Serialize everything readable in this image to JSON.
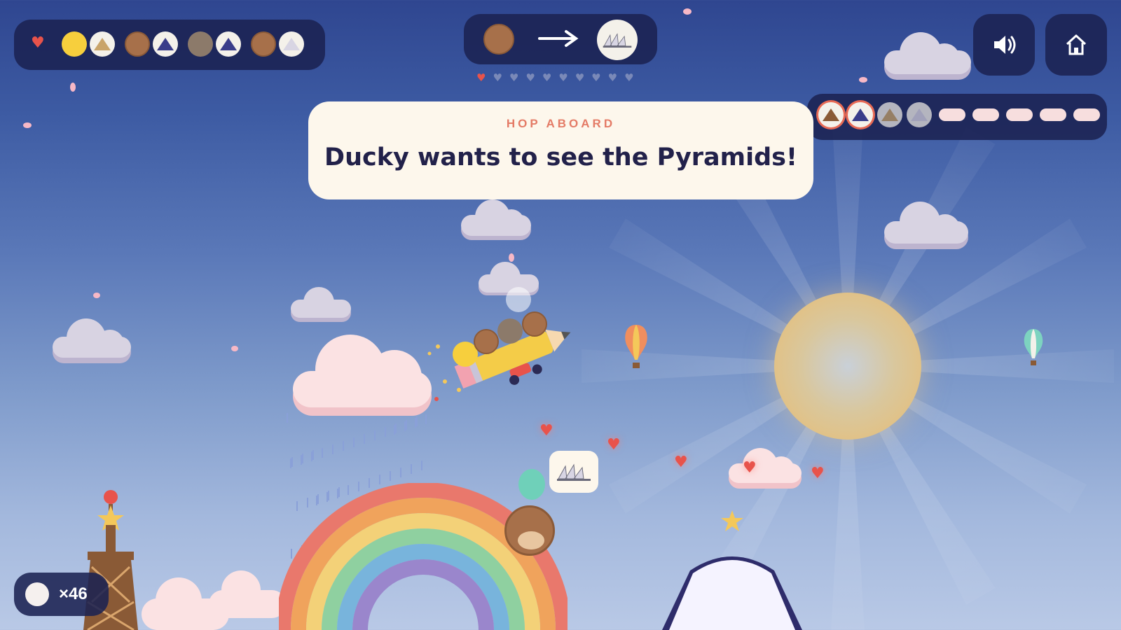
{
  "hud": {
    "passengers": {
      "lives_icon": "heart-icon",
      "pairs": [
        {
          "rider": "duck",
          "destination": "pyramids"
        },
        {
          "rider": "bear",
          "destination": "mount-fuji"
        },
        {
          "rider": "hedgehog",
          "destination": "mount-fuji"
        },
        {
          "rider": "bear",
          "destination": "sydney-opera-house"
        }
      ]
    },
    "current_route": {
      "from": "bear",
      "arrow_icon": "arrow-right-icon",
      "to": "sydney-opera-house",
      "progress_filled": 1,
      "progress_total": 10
    },
    "sound_icon": "speaker-icon",
    "home_icon": "home-icon",
    "collection": {
      "visited": [
        "eiffel-tower",
        "mount-fuji"
      ],
      "known": [
        "pyramids",
        "sydney-opera-house"
      ],
      "locked_count": 5
    }
  },
  "banner": {
    "kicker": "HOP ABOARD",
    "message": "Ducky wants to see the Pyramids!"
  },
  "bunny_counter": {
    "label": "×46"
  },
  "scene": {
    "waiting_passenger": "bear",
    "waiting_destination": "sydney-opera-house",
    "hearts_count": 5
  },
  "colors": {
    "accent": "#e86a55",
    "panel": "#1b2252",
    "banner_bg": "#fdf7ec",
    "banner_text": "#22214a"
  }
}
